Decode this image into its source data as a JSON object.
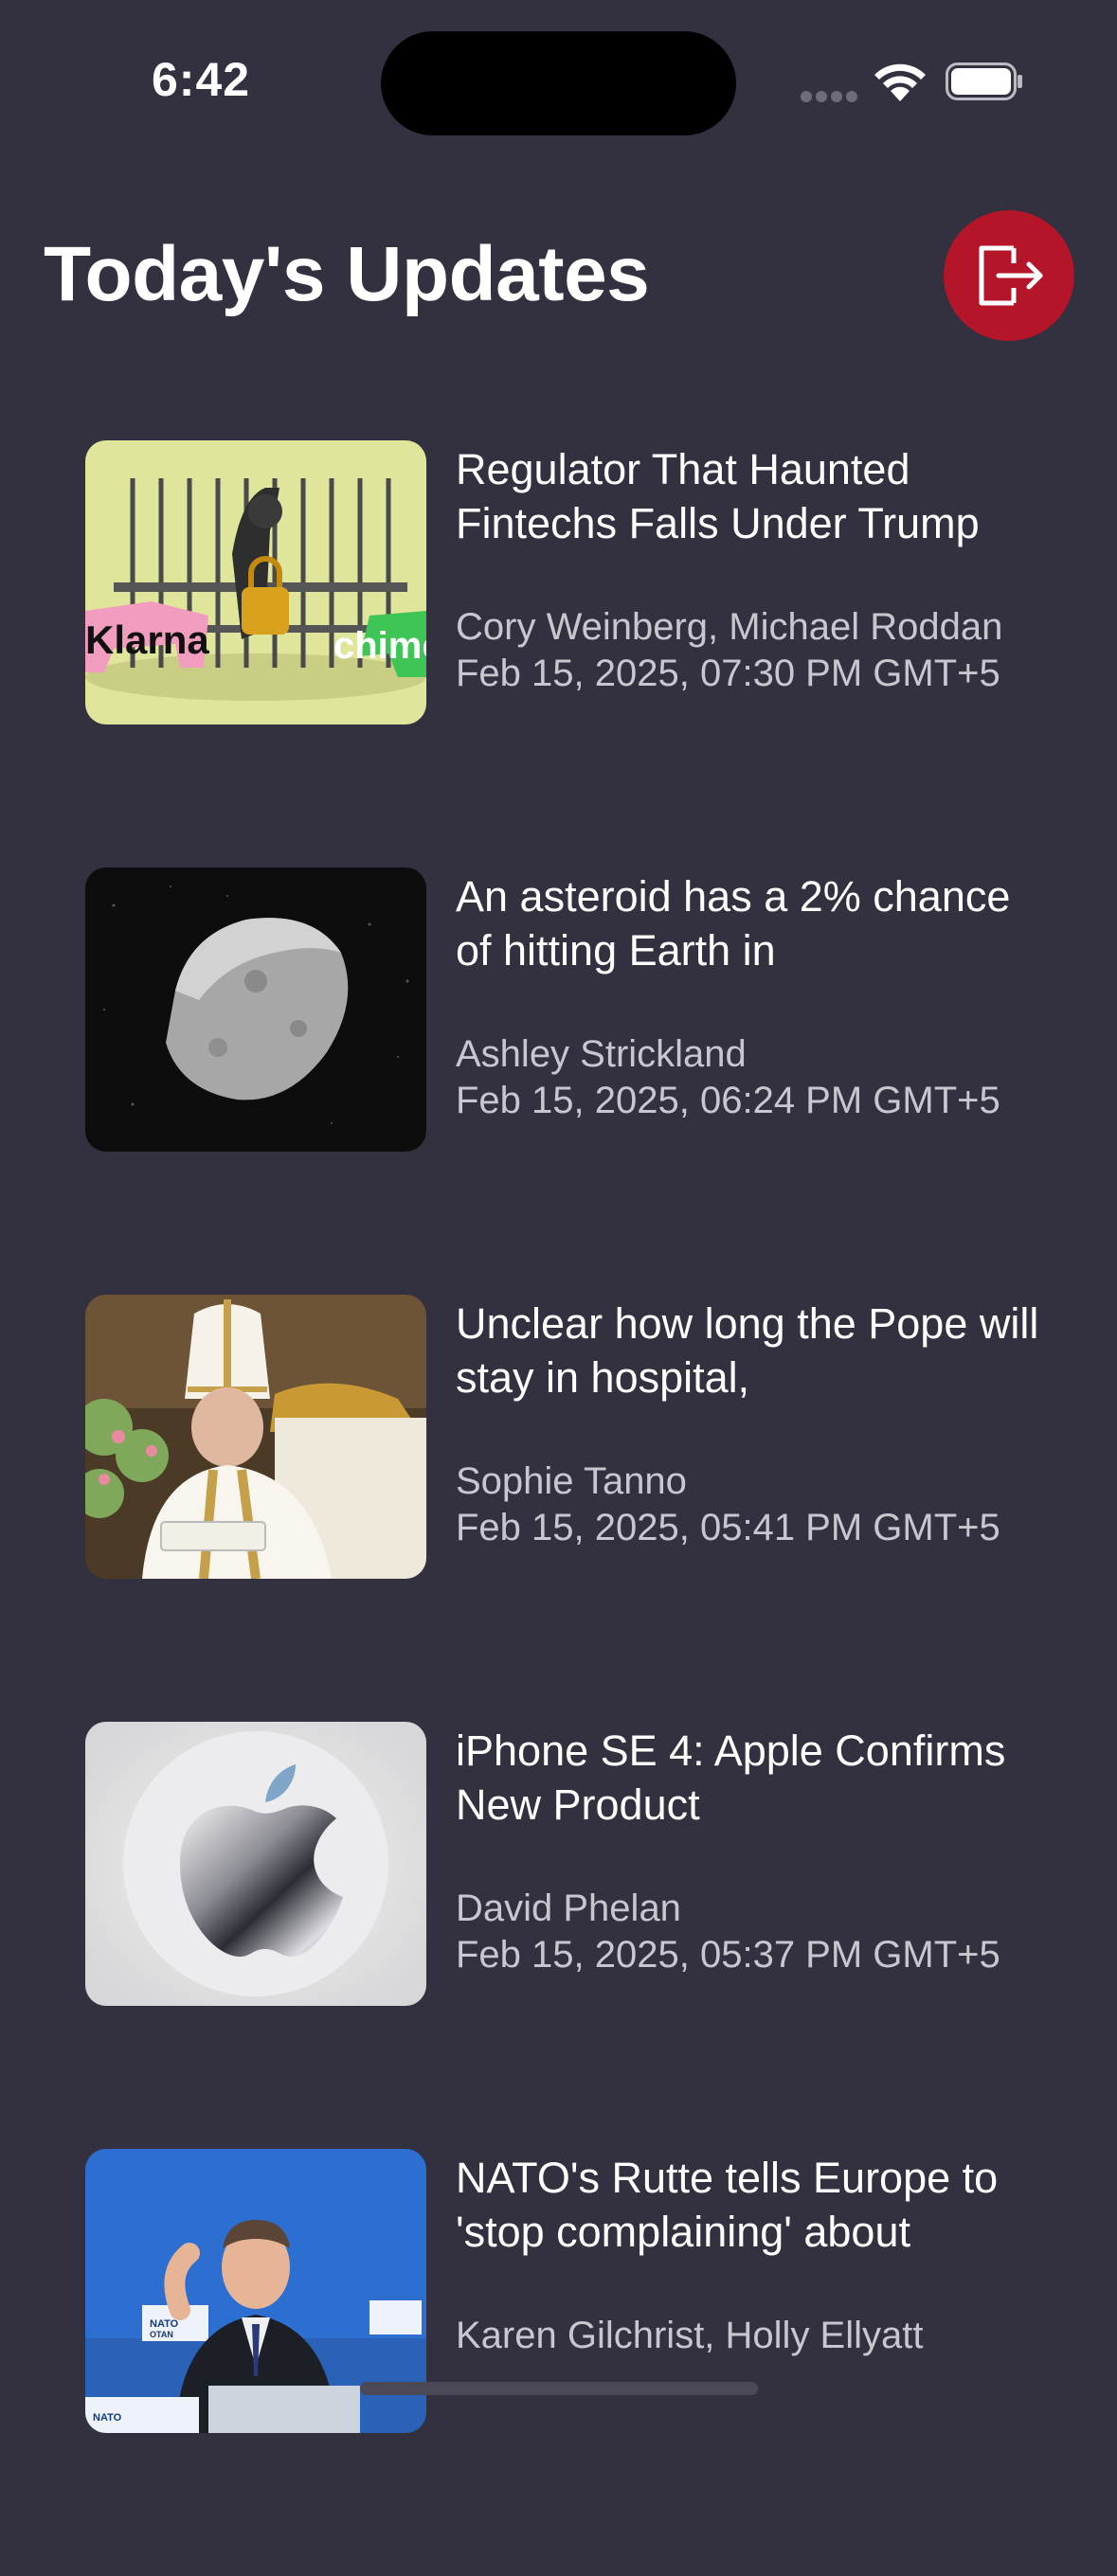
{
  "status_bar": {
    "time": "6:42"
  },
  "header": {
    "title": "Today's Updates",
    "logout_icon": "logout-icon",
    "logout_color": "#b41529"
  },
  "articles": [
    {
      "headline": "Regulator That Haunted Fintechs Falls Under Trump",
      "authors": "Cory Weinberg, Michael Roddan",
      "date": "Feb 15, 2025, 07:30 PM GMT+5",
      "image": "klarna-chime-dog-cage-illustration",
      "image_text": {
        "left": "Klarna",
        "right": "chime"
      }
    },
    {
      "headline": "An asteroid has a 2% chance of hitting Earth in",
      "authors": "Ashley Strickland",
      "date": "Feb 15, 2025, 06:24 PM GMT+5",
      "image": "asteroid-in-space"
    },
    {
      "headline": "Unclear how long the Pope will stay in hospital,",
      "authors": "Sophie Tanno",
      "date": "Feb 15, 2025, 05:41 PM GMT+5",
      "image": "pope-in-vestments"
    },
    {
      "headline": "iPhone SE 4: Apple Confirms New Product",
      "authors": "David Phelan",
      "date": "Feb 15, 2025, 05:37 PM GMT+5",
      "image": "apple-logo-chrome"
    },
    {
      "headline": "NATO's Rutte tells Europe to 'stop complaining' about",
      "authors": "Karen Gilchrist, Holly Ellyatt",
      "date": "",
      "image": "speaker-at-nato-podium",
      "image_text": {
        "logo": "NATO OTAN"
      }
    }
  ],
  "colors": {
    "background": "#33303f",
    "meta_text": "#c9c6cf",
    "accent": "#b41529"
  }
}
